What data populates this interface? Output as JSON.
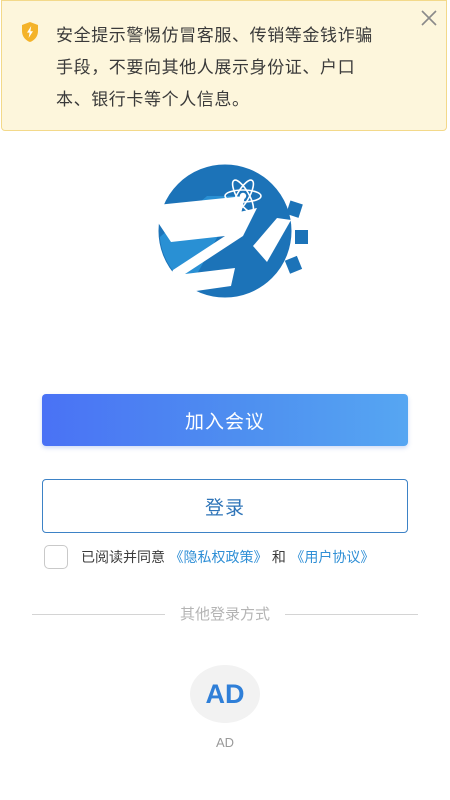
{
  "notice": {
    "icon": "shield-warning-icon",
    "lines": [
      "安全提示警惕仿冒客服、传销等金钱诈骗",
      "手段，不要向其他人展示身份证、户口",
      "本、银行卡等个人信息。"
    ],
    "close_icon": "close-icon",
    "background": "#fdf6dc",
    "icon_color": "#f4b32a"
  },
  "logo": {
    "name": "app-logo",
    "brand_color": "#1c73b8"
  },
  "actions": {
    "join_label": "加入会议",
    "login_label": "登录"
  },
  "agreement": {
    "checked": false,
    "prefix": "已阅读并同意",
    "privacy_link": "《隐私权政策》",
    "conjunction": "和",
    "user_link": "《用户协议》"
  },
  "other_login": {
    "divider_label": "其他登录方式",
    "methods": [
      {
        "icon_text": "AD",
        "label": "AD"
      }
    ]
  },
  "colors": {
    "primary_gradient_start": "#4a72f5",
    "primary_gradient_end": "#56a6f2",
    "outline": "#3d82c6",
    "link": "#2f8fd6"
  }
}
